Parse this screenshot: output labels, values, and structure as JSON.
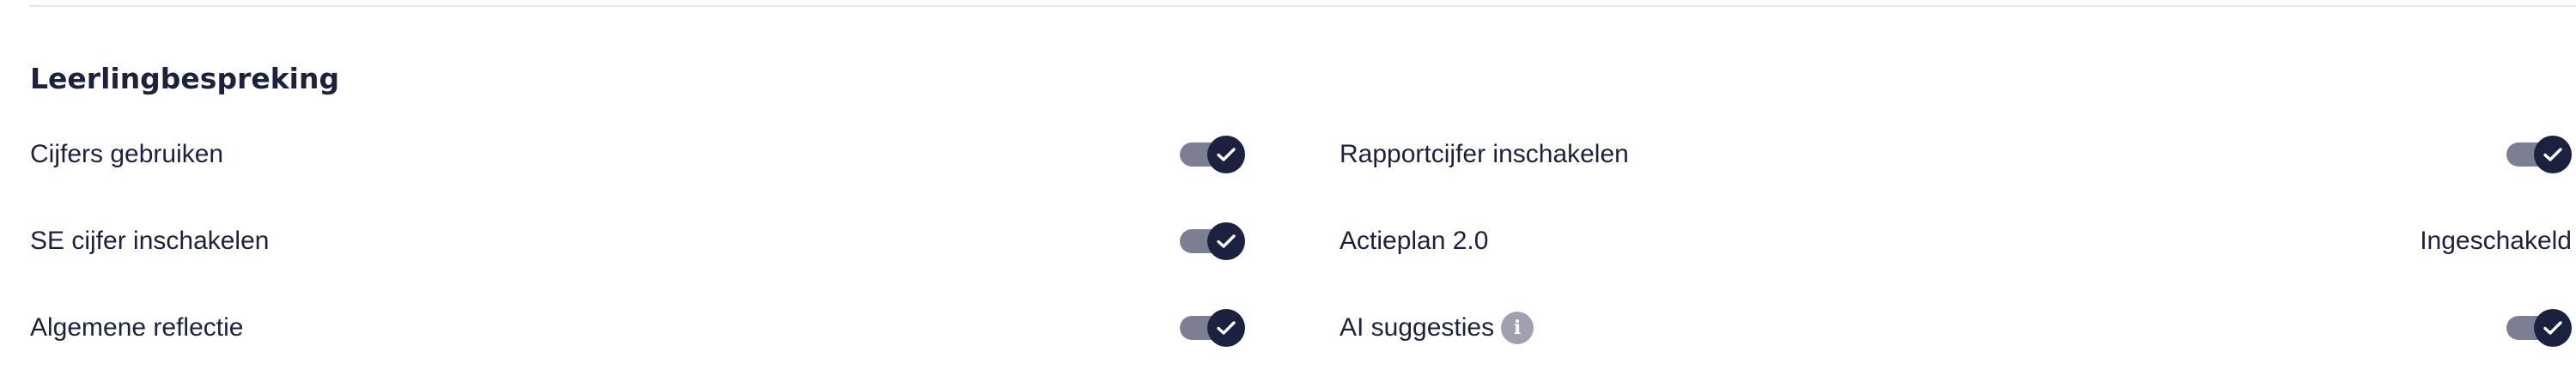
{
  "section": {
    "title": "Leerlingbespreking"
  },
  "settings": {
    "cijfers_gebruiken": {
      "label": "Cijfers gebruiken",
      "enabled": true
    },
    "rapportcijfer": {
      "label": "Rapportcijfer inschakelen",
      "enabled": true
    },
    "se_cijfer": {
      "label": "SE cijfer inschakelen",
      "enabled": true
    },
    "actieplan": {
      "label": "Actieplan 2.0",
      "status": "Ingeschakeld"
    },
    "algemene_reflectie": {
      "label": "Algemene reflectie",
      "enabled": true
    },
    "ai_suggesties": {
      "label": "AI suggesties",
      "info_icon": "info-icon",
      "info_glyph": "i",
      "enabled": true
    }
  },
  "colors": {
    "text": "#1d2140",
    "toggle_track": "#7c7f93",
    "toggle_knob": "#1d2140",
    "info_icon": "#9fa1b0",
    "divider": "#e4e5ea"
  }
}
